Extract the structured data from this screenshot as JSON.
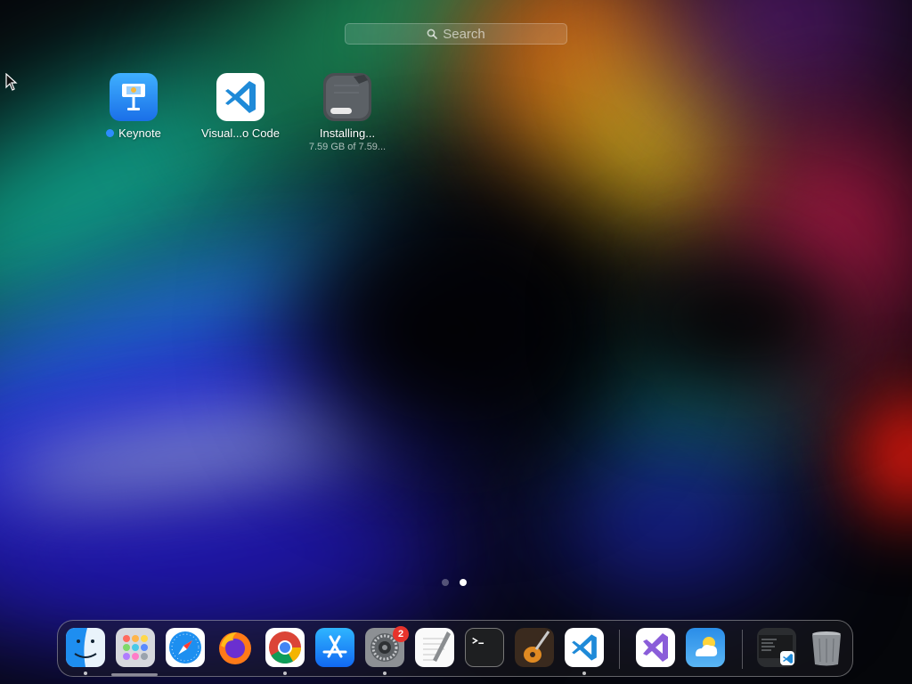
{
  "search": {
    "placeholder": "Search"
  },
  "launchpad_apps": [
    {
      "name": "Keynote",
      "new_indicator": true
    },
    {
      "name": "Visual...o Code"
    },
    {
      "name": "Installing...",
      "detail": "7.59 GB of 7.59..."
    }
  ],
  "pages": {
    "count": 2,
    "current": 2
  },
  "dock": {
    "items": [
      {
        "icon": "finder-icon",
        "running": true
      },
      {
        "icon": "launchpad-icon",
        "running": false
      },
      {
        "icon": "safari-icon",
        "running": false
      },
      {
        "icon": "firefox-icon",
        "running": false
      },
      {
        "icon": "chrome-icon",
        "running": true
      },
      {
        "icon": "app-store-icon",
        "running": false
      },
      {
        "icon": "system-settings-icon",
        "running": true,
        "badge": "2"
      },
      {
        "icon": "textedit-icon",
        "running": false
      },
      {
        "icon": "terminal-icon",
        "running": false
      },
      {
        "icon": "garageband-icon",
        "running": false
      },
      {
        "icon": "vscode-icon",
        "running": true
      },
      {
        "icon": "visual-studio-icon",
        "running": false
      },
      {
        "icon": "weather-icon",
        "running": false
      },
      {
        "icon": "downloads-stack-icon",
        "running": false
      },
      {
        "icon": "trash-icon",
        "running": false
      }
    ]
  },
  "colors": {
    "accent": "#2d8cff",
    "badge": "#e8332c"
  }
}
